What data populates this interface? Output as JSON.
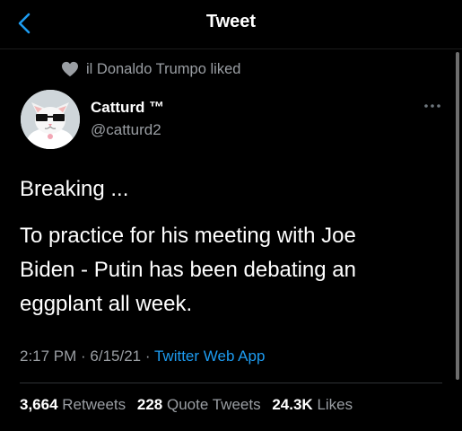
{
  "header": {
    "title": "Tweet",
    "back_icon": "chevron-left-icon",
    "accent_color": "#1d9bf0"
  },
  "social_context": {
    "icon": "heart-icon",
    "text": "il Donaldo Trumpo liked"
  },
  "author": {
    "display_name": "Catturd ™",
    "handle": "@catturd2",
    "avatar": "cat-with-glasses-avatar"
  },
  "more_icon": "more-options-icon",
  "tweet": {
    "lines": [
      "Breaking ...",
      "To practice for his meeting with Joe",
      "Biden - Putin has been debating an",
      "eggplant all week."
    ]
  },
  "meta": {
    "time": "2:17 PM",
    "date": "6/15/21",
    "separator": " · ",
    "source": "Twitter Web App"
  },
  "stats": {
    "retweets_count": "3,664",
    "retweets_label": "Retweets",
    "quotes_count": "228",
    "quotes_label": "Quote Tweets",
    "likes_count": "24.3K",
    "likes_label": "Likes"
  }
}
